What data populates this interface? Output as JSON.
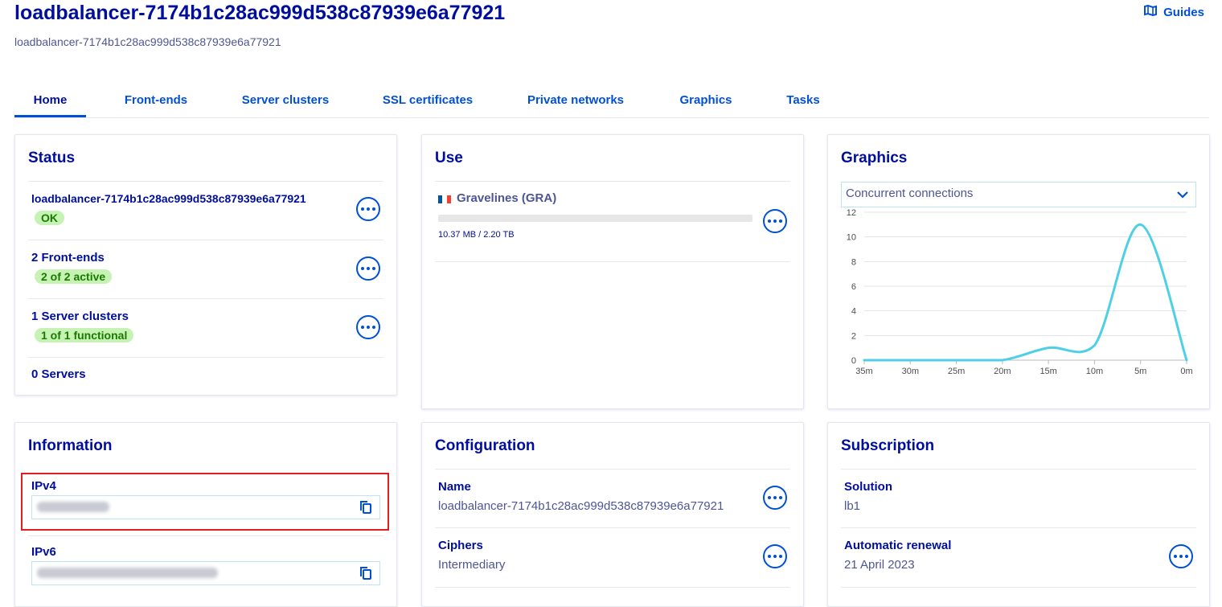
{
  "header": {
    "title": "loadbalancer-7174b1c28ac999d538c87939e6a77921",
    "subtitle": "loadbalancer-7174b1c28ac999d538c87939e6a77921",
    "guides_label": "Guides"
  },
  "tabs": [
    {
      "label": "Home",
      "active": true
    },
    {
      "label": "Front-ends"
    },
    {
      "label": "Server clusters"
    },
    {
      "label": "SSL certificates"
    },
    {
      "label": "Private networks"
    },
    {
      "label": "Graphics"
    },
    {
      "label": "Tasks"
    }
  ],
  "status": {
    "title": "Status",
    "rows": [
      {
        "label": "loadbalancer-7174b1c28ac999d538c87939e6a77921",
        "badge": "OK"
      },
      {
        "label": "2 Front-ends",
        "badge": "2 of 2 active"
      },
      {
        "label": "1 Server clusters",
        "badge": "1 of 1 functional"
      },
      {
        "label": "0 Servers"
      }
    ]
  },
  "use": {
    "title": "Use",
    "location": "Gravelines (GRA)",
    "usage_text": "10.37 MB / 2.20 TB",
    "usage_fraction": 4.7e-06
  },
  "graphics": {
    "title": "Graphics",
    "select_value": "Concurrent connections"
  },
  "chart_data": {
    "type": "line",
    "title": "",
    "xlabel": "",
    "ylabel": "",
    "x": [
      "35m",
      "30m",
      "25m",
      "20m",
      "15m",
      "10m",
      "5m",
      "0m"
    ],
    "series": [
      {
        "values": [
          0,
          0,
          0,
          0,
          1,
          1.2,
          11,
          0
        ]
      }
    ],
    "ylim": [
      0,
      12
    ],
    "yticks": [
      0,
      2,
      4,
      6,
      8,
      10,
      12
    ],
    "grid": true,
    "color": "#4dd0e6"
  },
  "information": {
    "title": "Information",
    "ipv4_label": "IPv4",
    "ipv6_label": "IPv6"
  },
  "configuration": {
    "title": "Configuration",
    "name_label": "Name",
    "name_value": "loadbalancer-7174b1c28ac999d538c87939e6a77921",
    "ciphers_label": "Ciphers",
    "ciphers_value": "Intermediary"
  },
  "subscription": {
    "title": "Subscription",
    "solution_label": "Solution",
    "solution_value": "lb1",
    "renewal_label": "Automatic renewal",
    "renewal_value": "21 April 2023"
  },
  "colors": {
    "primary": "#000e9c",
    "link": "#0050d7",
    "badge_bg": "#c6f2b3",
    "badge_text": "#1a7a00",
    "highlight": "#e02020"
  }
}
